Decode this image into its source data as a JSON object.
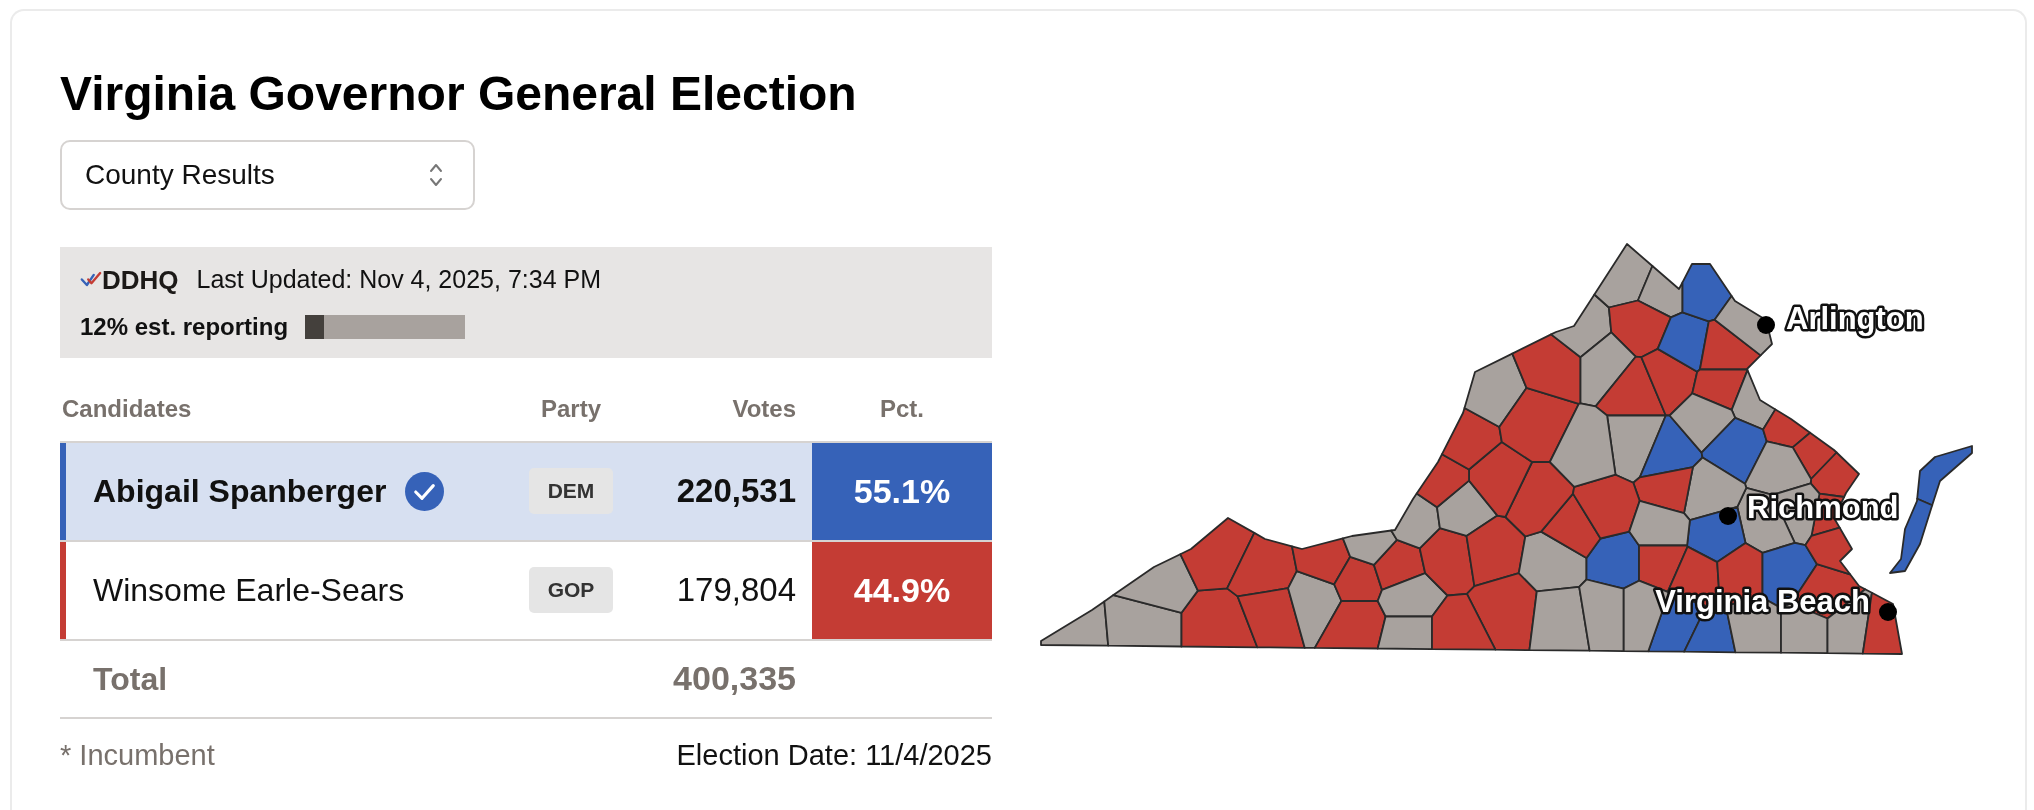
{
  "title": "Virginia Governor General Election",
  "view_select": {
    "value": "County Results"
  },
  "status": {
    "logo": "DDHQ",
    "last_updated": "Last Updated: Nov 4, 2025, 7:34 PM",
    "reporting": "12% est. reporting",
    "level": 0.12
  },
  "table": {
    "columns": [
      "Candidates",
      "Party",
      "Votes",
      "Pct."
    ],
    "rows": [
      {
        "name": "Abigail Spanberger",
        "winner": true,
        "party": "DEM",
        "votes": "220,531",
        "pct": "55.1%",
        "color": "#3662b8"
      },
      {
        "name": "Winsome Earle-Sears",
        "winner": false,
        "party": "GOP",
        "votes": "179,804",
        "pct": "44.9%",
        "color": "#c43c34"
      }
    ],
    "total": {
      "label": "Total",
      "votes": "400,335"
    }
  },
  "footer": {
    "note": "* Incumbent",
    "election_date": "Election Date: 11/4/2025"
  },
  "map": {
    "counties": [
      {
        "color": "#a8a29e"
      },
      {
        "color": "#a8a29e"
      },
      {
        "color": "#c43c34"
      },
      {
        "color": "#a8a29e"
      },
      {
        "color": "#c43c34"
      },
      {
        "color": "#c43c34"
      },
      {
        "color": "#c43c34"
      },
      {
        "color": "#a8a29e"
      },
      {
        "color": "#c43c34"
      },
      {
        "color": "#c43c34"
      },
      {
        "color": "#c43c34"
      },
      {
        "color": "#c43c34"
      },
      {
        "color": "#a8a29e"
      },
      {
        "color": "#a8a29e"
      },
      {
        "color": "#c43c34"
      },
      {
        "color": "#a8a29e"
      },
      {
        "color": "#a8a29e"
      },
      {
        "color": "#a8a29e"
      },
      {
        "color": "#c43c34"
      },
      {
        "color": "#c43c34"
      },
      {
        "color": "#c43c34"
      },
      {
        "color": "#a8a29e"
      },
      {
        "color": "#a8a29e"
      },
      {
        "color": "#3662b8"
      },
      {
        "color": "#c43c34"
      },
      {
        "color": "#c43c34"
      },
      {
        "color": "#c43c34"
      },
      {
        "color": "#c43c34"
      },
      {
        "color": "#c43c34"
      },
      {
        "color": "#a8a29e"
      },
      {
        "color": "#c43c34"
      },
      {
        "color": "#c43c34"
      },
      {
        "color": "#a8a29e"
      },
      {
        "color": "#a8a29e"
      },
      {
        "color": "#a8a29e"
      },
      {
        "color": "#c43c34"
      },
      {
        "color": "#a8a29e"
      },
      {
        "color": "#c43c34"
      },
      {
        "color": "#c43c34"
      },
      {
        "color": "#3662b8"
      },
      {
        "color": "#3662b8"
      },
      {
        "color": "#c43c34"
      },
      {
        "color": "#a8a29e"
      },
      {
        "color": "#c43c34"
      },
      {
        "color": "#a8a29e"
      },
      {
        "color": "#a8a29e"
      },
      {
        "color": "#3662b8"
      },
      {
        "color": "#a8a29e"
      },
      {
        "color": "#3662b8"
      },
      {
        "color": "#c43c34"
      },
      {
        "color": "#c43c34"
      },
      {
        "color": "#c43c34"
      },
      {
        "color": "#a8a29e"
      },
      {
        "color": "#c43c34"
      },
      {
        "color": "#a8a29e"
      },
      {
        "color": "#a8a29e"
      },
      {
        "color": "#a8a29e"
      },
      {
        "color": "#c43c34"
      },
      {
        "color": "#3662b8"
      },
      {
        "color": "#c43c34"
      },
      {
        "color": "#a8a29e"
      },
      {
        "color": "#a8a29e"
      },
      {
        "color": "#c43c34"
      },
      {
        "color": "#c43c34"
      },
      {
        "color": "#c43c34"
      },
      {
        "color": "#3662b8"
      },
      {
        "color": "#c43c34"
      },
      {
        "color": "#c43c34"
      },
      {
        "color": "#3662b8"
      },
      {
        "color": "#3662b8"
      },
      {
        "color": "#a8a29e"
      },
      {
        "color": "#a8a29e"
      },
      {
        "color": "#a8a29e"
      },
      {
        "color": "#c43c34"
      },
      {
        "color": "#a8a29e"
      },
      {
        "color": "#a8a29e"
      },
      {
        "color": "#3662b8"
      },
      {
        "color": "#3662b8"
      }
    ],
    "cities": [
      {
        "name": "Arlington"
      },
      {
        "name": "Richmond"
      },
      {
        "name": "Virginia Beach"
      }
    ]
  }
}
